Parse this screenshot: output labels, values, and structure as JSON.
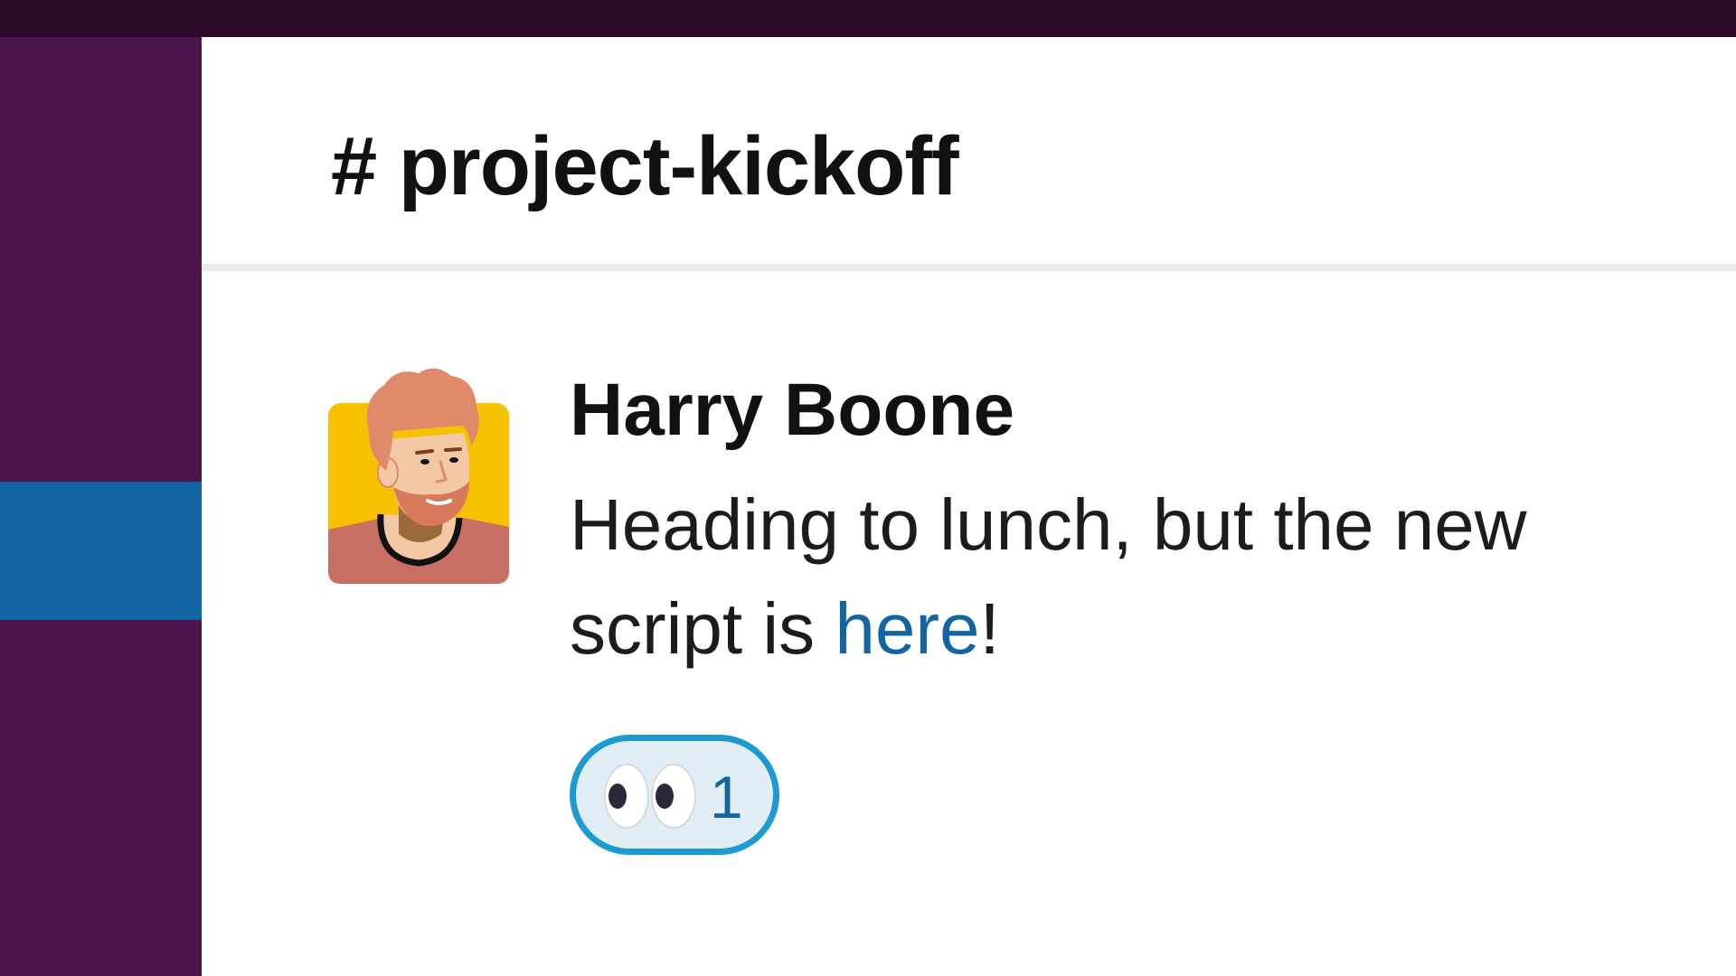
{
  "colors": {
    "topbar": "#2b0a28",
    "sidebar": "#4a154b",
    "sidebar_active": "#1264a3",
    "link": "#1264a3",
    "reaction_border": "#1d9bd1",
    "reaction_bg": "#e1eef6"
  },
  "channel": {
    "title": "# project-kickoff"
  },
  "message": {
    "author": "Harry Boone",
    "avatar_icon": "bearded-man-avatar",
    "text_before": "Heading to lunch, but the new script is ",
    "link_text": "here",
    "text_after": "!",
    "reaction": {
      "emoji_icon": "eyes-icon",
      "count": "1"
    }
  }
}
